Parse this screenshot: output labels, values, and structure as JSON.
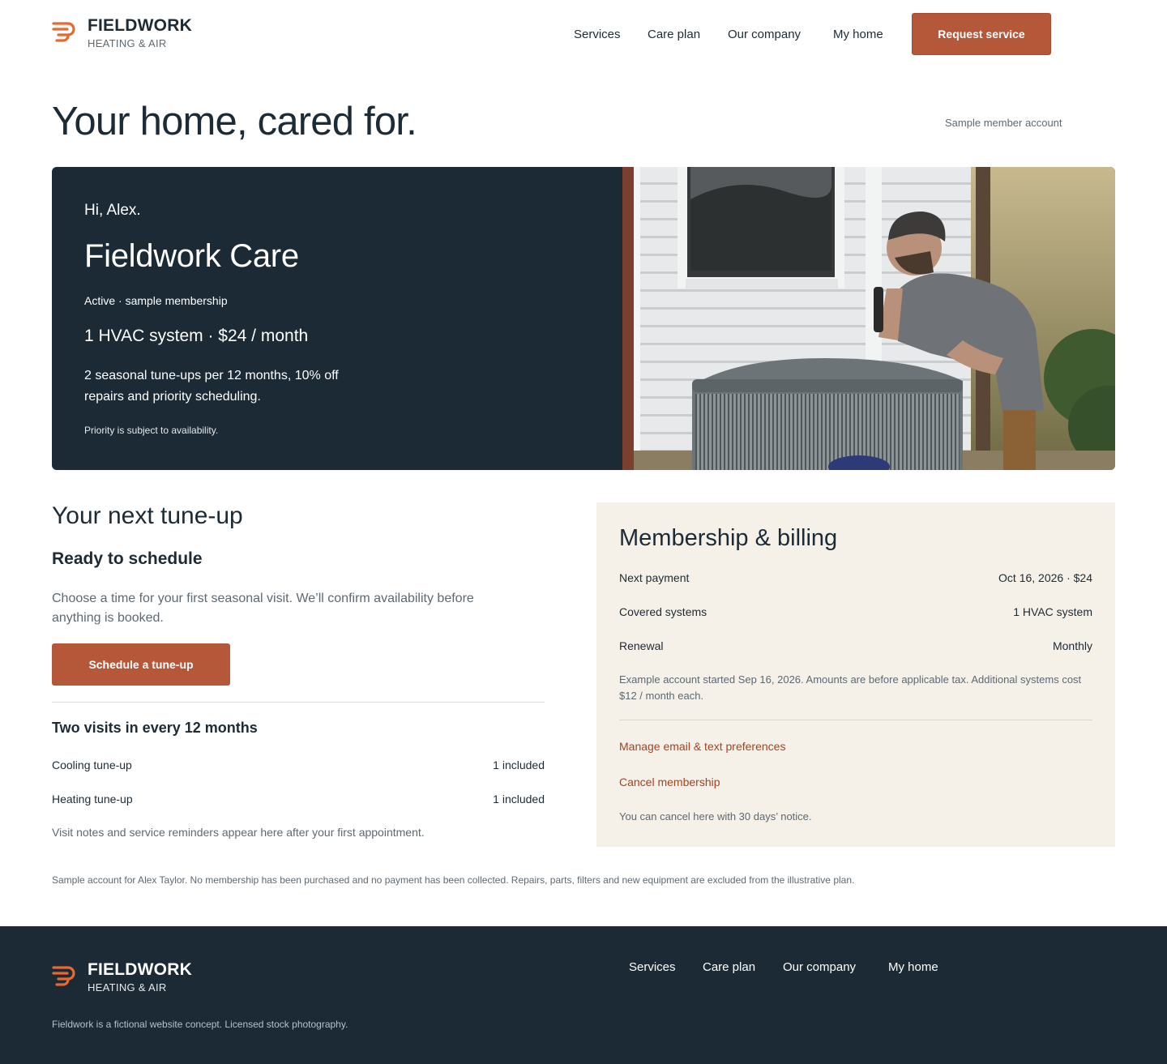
{
  "header": {
    "brand": "FIELDWORK",
    "brand_sub": "HEATING & AIR",
    "nav": [
      "Services",
      "Care plan",
      "Our company",
      "My home"
    ],
    "cta": "Request service"
  },
  "page": {
    "title": "Your home, cared for.",
    "sample_label": "Sample member account"
  },
  "hero": {
    "greeting": "Hi, Alex.",
    "plan_name": "Fieldwork Care",
    "status": "Active · sample membership",
    "price": "1 HVAC system · $24 / month",
    "benefits": "2 seasonal tune-ups per 12 months, 10% off repairs and priority scheduling.",
    "fine_print": "Priority is subject to availability.",
    "photo_alt": "technician-inspecting-ac-unit"
  },
  "tuneup": {
    "heading": "Your next tune-up",
    "subheading": "Ready to schedule",
    "description": "Choose a time for your first seasonal visit. We’ll confirm availability before anything is booked.",
    "button": "Schedule a tune-up",
    "visits_heading": "Two visits in every 12 months",
    "visits": [
      {
        "label": "Cooling tune-up",
        "value": "1 included"
      },
      {
        "label": "Heating tune-up",
        "value": "1 included"
      }
    ],
    "note": "Visit notes and service reminders appear here after your first appointment."
  },
  "billing": {
    "heading": "Membership & billing",
    "rows": [
      {
        "label": "Next payment",
        "value": "Oct 16, 2026 · $24"
      },
      {
        "label": "Covered systems",
        "value": "1 HVAC system"
      },
      {
        "label": "Renewal",
        "value": "Monthly"
      }
    ],
    "note": "Example account started Sep 16, 2026. Amounts are before applicable tax. Additional systems cost $12 / month each.",
    "link_preferences": "Manage email & text preferences",
    "link_cancel": "Cancel membership",
    "cancel_note": "You can cancel here with 30 days’ notice."
  },
  "disclaimer": "Sample account for Alex Taylor. No membership has been purchased and no payment has been collected. Repairs, parts, filters and new equipment are excluded from the illustrative plan.",
  "footer": {
    "brand": "FIELDWORK",
    "brand_sub": "HEATING & AIR",
    "nav": [
      "Services",
      "Care plan",
      "Our company",
      "My home"
    ],
    "note": "Fieldwork is a fictional website concept. Licensed stock photography."
  },
  "colors": {
    "accent": "#b5583a",
    "navy": "#1b2a35",
    "cream": "#f5f0e8",
    "link": "#a6431f",
    "logo": "#e8692f"
  }
}
